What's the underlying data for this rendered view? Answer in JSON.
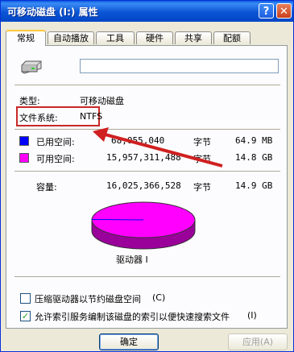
{
  "window": {
    "title": "可移动磁盘 (I:) 属性",
    "help_label": "?",
    "close_label": "✕"
  },
  "tabs": [
    {
      "label": "常规",
      "active": true
    },
    {
      "label": "自动播放"
    },
    {
      "label": "工具"
    },
    {
      "label": "硬件"
    },
    {
      "label": "共享"
    },
    {
      "label": "配额"
    }
  ],
  "general": {
    "name_value": "",
    "type_label": "类型:",
    "type_value": "可移动磁盘",
    "fs_label": "文件系统:",
    "fs_value": "NTFS",
    "used_label": "已用空间:",
    "used_bytes": "68,055,040",
    "used_unit": "字节",
    "used_size": "64.9 MB",
    "free_label": "可用空间:",
    "free_bytes": "15,957,311,488",
    "free_unit": "字节",
    "free_size": "14.8 GB",
    "capacity_label": "容量:",
    "capacity_bytes": "16,025,366,528",
    "capacity_unit": "字节",
    "capacity_size": "14.9 GB",
    "drive_label": "驱动器 I",
    "used_color": "#0000ff",
    "free_color": "#ff00ff",
    "used_fraction": 0.004
  },
  "options": {
    "compress_label": "压缩驱动器以节约磁盘空间",
    "compress_key": "(C)",
    "compress_checked": false,
    "index_label": "允许索引服务编制该磁盘的索引以便快速搜索文件",
    "index_key": "(I)",
    "index_checked": true
  },
  "buttons": {
    "ok": "确定",
    "apply": "应用(A)"
  }
}
